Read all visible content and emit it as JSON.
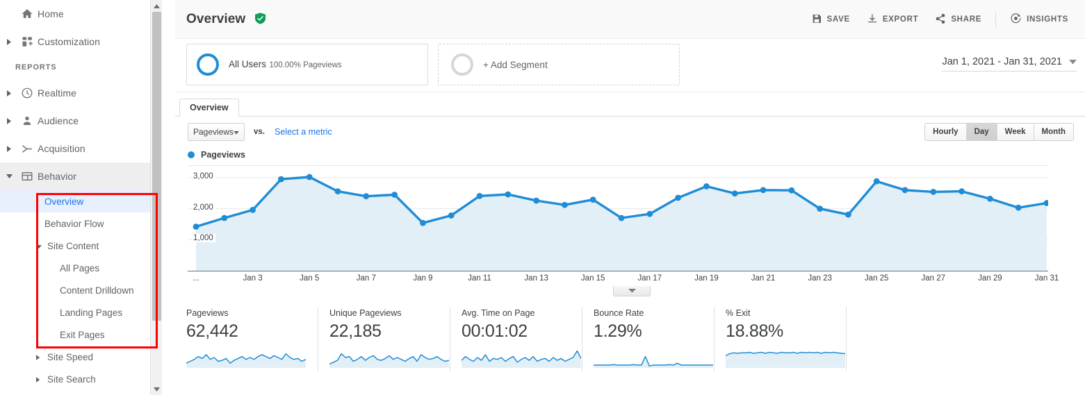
{
  "sidebar": {
    "items": [
      {
        "label": "Home",
        "icon": "home-icon",
        "expandable": false
      },
      {
        "label": "Customization",
        "icon": "customization-icon",
        "expandable": true
      }
    ],
    "section_header": "REPORTS",
    "reports": [
      {
        "label": "Realtime",
        "icon": "clock-icon",
        "expandable": true,
        "expanded": false
      },
      {
        "label": "Audience",
        "icon": "person-icon",
        "expandable": true,
        "expanded": false
      },
      {
        "label": "Acquisition",
        "icon": "acquisition-icon",
        "expandable": true,
        "expanded": false
      },
      {
        "label": "Behavior",
        "icon": "behavior-icon",
        "expandable": true,
        "expanded": true
      }
    ],
    "behavior_children": [
      {
        "label": "Overview",
        "level": 1,
        "selected": true,
        "caret": false
      },
      {
        "label": "Behavior Flow",
        "level": 1,
        "selected": false,
        "caret": false
      },
      {
        "label": "Site Content",
        "level": 1,
        "selected": false,
        "caret": true,
        "caret_state": "expanded"
      },
      {
        "label": "All Pages",
        "level": 2,
        "selected": false,
        "caret": false
      },
      {
        "label": "Content Drilldown",
        "level": 2,
        "selected": false,
        "caret": false
      },
      {
        "label": "Landing Pages",
        "level": 2,
        "selected": false,
        "caret": false
      },
      {
        "label": "Exit Pages",
        "level": 2,
        "selected": false,
        "caret": false
      },
      {
        "label": "Site Speed",
        "level": 1,
        "selected": false,
        "caret": true,
        "caret_state": "collapsed"
      },
      {
        "label": "Site Search",
        "level": 1,
        "selected": false,
        "caret": true,
        "caret_state": "collapsed"
      }
    ],
    "annotation": {
      "color": "#ff0000",
      "shape": "rectangle-highlight"
    }
  },
  "header": {
    "title": "Overview",
    "verified_icon": "verified-shield-icon",
    "actions": [
      {
        "label": "SAVE",
        "icon": "save-floppy-icon"
      },
      {
        "label": "EXPORT",
        "icon": "download-icon"
      },
      {
        "label": "SHARE",
        "icon": "share-icon"
      },
      {
        "label": "INSIGHTS",
        "icon": "insights-icon"
      }
    ]
  },
  "segments": {
    "all_users": {
      "title": "All Users",
      "subtitle": "100.00% Pageviews",
      "ring_color": "#1f8cd6"
    },
    "add_segment": {
      "label": "+ Add Segment",
      "ring_color": "#d6d6d6"
    }
  },
  "date_range": {
    "value": "Jan 1, 2021 - Jan 31, 2021",
    "icon": "chevron-down-icon"
  },
  "tabs": [
    {
      "label": "Overview",
      "active": true
    }
  ],
  "controls": {
    "metric_select": {
      "value": "Pageviews",
      "icon": "chevron-down-icon"
    },
    "vs_label": "vs.",
    "select_metric_link": "Select a metric",
    "granularity": [
      {
        "label": "Hourly",
        "active": false
      },
      {
        "label": "Day",
        "active": true
      },
      {
        "label": "Week",
        "active": false
      },
      {
        "label": "Month",
        "active": false
      }
    ]
  },
  "chart_data": {
    "type": "area",
    "title": "",
    "legend": [
      "Pageviews"
    ],
    "legend_position": "top-left",
    "series_color": "#1f8cd6",
    "fill_color": "#e3eff7",
    "xlabel": "",
    "ylabel": "",
    "ylim": [
      0,
      3400
    ],
    "yticks": [
      1000,
      2000,
      3000
    ],
    "ytick_labels": [
      "1,000",
      "2,000",
      "3,000"
    ],
    "grid": true,
    "x_leading_ellipsis": "...",
    "xtick_labels": [
      "Jan 3",
      "Jan 5",
      "Jan 7",
      "Jan 9",
      "Jan 11",
      "Jan 13",
      "Jan 15",
      "Jan 17",
      "Jan 19",
      "Jan 21",
      "Jan 23",
      "Jan 25",
      "Jan 27",
      "Jan 29",
      "Jan 31"
    ],
    "x": [
      "Jan 1",
      "Jan 2",
      "Jan 3",
      "Jan 4",
      "Jan 5",
      "Jan 6",
      "Jan 7",
      "Jan 8",
      "Jan 9",
      "Jan 10",
      "Jan 11",
      "Jan 12",
      "Jan 13",
      "Jan 14",
      "Jan 15",
      "Jan 16",
      "Jan 17",
      "Jan 18",
      "Jan 19",
      "Jan 20",
      "Jan 21",
      "Jan 22",
      "Jan 23",
      "Jan 24",
      "Jan 25",
      "Jan 26",
      "Jan 27",
      "Jan 28",
      "Jan 29",
      "Jan 30",
      "Jan 31"
    ],
    "values": [
      1420,
      1700,
      1960,
      2950,
      3020,
      2560,
      2400,
      2450,
      1540,
      1780,
      2410,
      2460,
      2260,
      2120,
      2290,
      1700,
      1830,
      2350,
      2720,
      2490,
      2600,
      2590,
      2000,
      1810,
      2880,
      2600,
      2540,
      2560,
      2320,
      2030,
      2180
    ],
    "series": [
      {
        "name": "Pageviews",
        "values": [
          1420,
          1700,
          1960,
          2950,
          3020,
          2560,
          2400,
          2450,
          1540,
          1780,
          2410,
          2460,
          2260,
          2120,
          2290,
          1700,
          1830,
          2350,
          2720,
          2490,
          2600,
          2590,
          2000,
          1810,
          2880,
          2600,
          2540,
          2560,
          2320,
          2030,
          2180
        ]
      }
    ]
  },
  "collapse_handle_icon": "chevron-down-icon",
  "kpis": [
    {
      "label": "Pageviews",
      "value": "62,442",
      "sparkline": [
        34,
        30,
        26,
        20,
        24,
        16,
        26,
        22,
        30,
        28,
        24,
        34,
        28,
        24,
        20,
        26,
        22,
        26,
        20,
        16,
        20,
        24,
        18,
        22,
        26,
        14,
        22,
        26,
        24,
        30,
        26
      ]
    },
    {
      "label": "Unique Pageviews",
      "value": "22,185",
      "sparkline": [
        36,
        32,
        28,
        14,
        22,
        20,
        30,
        26,
        20,
        28,
        22,
        18,
        26,
        28,
        24,
        18,
        26,
        22,
        26,
        30,
        24,
        20,
        30,
        16,
        22,
        26,
        24,
        20,
        26,
        30,
        28
      ]
    },
    {
      "label": "Avg. Time on Page",
      "value": "00:01:02",
      "sparkline": [
        28,
        20,
        26,
        30,
        22,
        28,
        16,
        30,
        24,
        26,
        22,
        30,
        24,
        20,
        32,
        26,
        22,
        28,
        20,
        30,
        26,
        24,
        30,
        22,
        28,
        24,
        30,
        26,
        22,
        8,
        24
      ]
    },
    {
      "label": "Bounce Rate",
      "value": "1.29%",
      "sparkline": [
        38,
        38,
        38,
        38,
        38,
        37,
        38,
        38,
        38,
        38,
        37,
        38,
        38,
        20,
        40,
        38,
        38,
        38,
        38,
        37,
        38,
        34,
        38,
        38,
        38,
        38,
        38,
        38,
        38,
        38,
        38
      ]
    },
    {
      "label": "% Exit",
      "value": "18.88%",
      "sparkline": [
        18,
        14,
        12,
        13,
        12,
        12,
        11,
        13,
        12,
        11,
        13,
        11,
        12,
        13,
        11,
        12,
        12,
        11,
        13,
        11,
        12,
        11,
        12,
        11,
        13,
        11,
        12,
        11,
        12,
        13,
        14
      ]
    }
  ]
}
